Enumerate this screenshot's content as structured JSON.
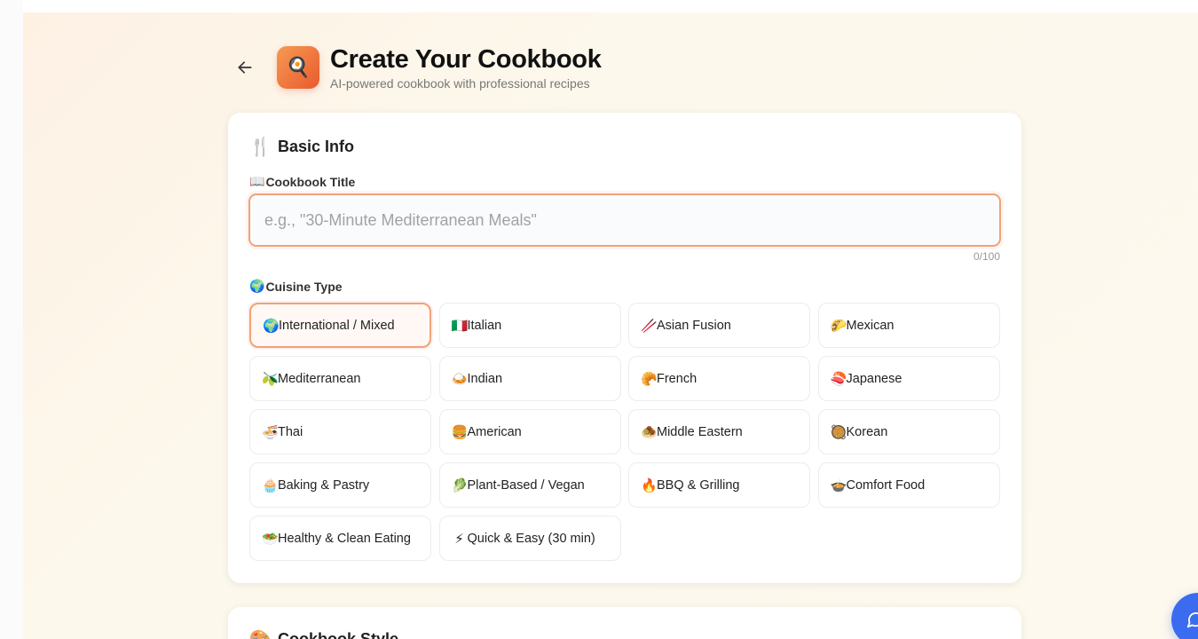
{
  "header": {
    "title": "Create Your Cookbook",
    "subtitle": "AI-powered cookbook with professional recipes",
    "logo_emoji": "🍳"
  },
  "basic_info": {
    "section_emoji": "🍴",
    "section_title": "Basic Info",
    "title_field": {
      "label_emoji": "📖",
      "label": "Cookbook Title",
      "value": "",
      "placeholder": "e.g., \"30-Minute Mediterranean Meals\"",
      "char_count": "0/100"
    },
    "cuisine": {
      "label_emoji": "🌍",
      "label": "Cuisine Type",
      "selected": "International / Mixed",
      "options": [
        {
          "emoji": "🌍",
          "label": "International / Mixed"
        },
        {
          "emoji": "🇮🇹",
          "label": "Italian"
        },
        {
          "emoji": "🥢",
          "label": "Asian Fusion"
        },
        {
          "emoji": "🌮",
          "label": "Mexican"
        },
        {
          "emoji": "🫒",
          "label": "Mediterranean"
        },
        {
          "emoji": "🍛",
          "label": "Indian"
        },
        {
          "emoji": "🥐",
          "label": "French"
        },
        {
          "emoji": "🍣",
          "label": "Japanese"
        },
        {
          "emoji": "🍜",
          "label": "Thai"
        },
        {
          "emoji": "🍔",
          "label": "American"
        },
        {
          "emoji": "🧆",
          "label": "Middle Eastern"
        },
        {
          "emoji": "🥘",
          "label": "Korean"
        },
        {
          "emoji": "🧁",
          "label": "Baking & Pastry"
        },
        {
          "emoji": "🥬",
          "label": "Plant-Based / Vegan"
        },
        {
          "emoji": "🔥",
          "label": "BBQ & Grilling"
        },
        {
          "emoji": "🍲",
          "label": "Comfort Food"
        },
        {
          "emoji": "🥗",
          "label": "Healthy & Clean Eating"
        },
        {
          "emoji": "⚡",
          "label": "Quick & Easy (30 min)"
        }
      ]
    }
  },
  "cookbook_style": {
    "section_emoji": "🎨",
    "section_title": "Cookbook Style"
  },
  "colors": {
    "accent": "#ea5a2e",
    "accent_border": "#f0a27a",
    "chat_button": "#3b6cf0"
  }
}
